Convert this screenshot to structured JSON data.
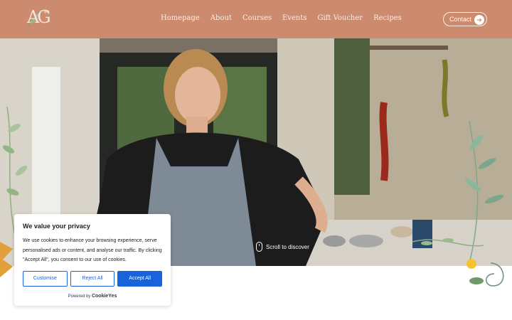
{
  "header": {
    "logo_text": "AG",
    "nav": [
      "Homepage",
      "About",
      "Courses",
      "Events",
      "Gift Voucher",
      "Recipes"
    ],
    "contact_label": "Contact",
    "bg_color": "#cc8a6e"
  },
  "hero": {
    "scroll_label": "Scroll to discover"
  },
  "cookie_banner": {
    "title": "We value your privacy",
    "body": "We use cookies to enhance your browsing experience, serve personalised ads or content, and analyse our traffic. By clicking \"Accept All\", you consent to our use of cookies.",
    "customise_label": "Customise",
    "reject_label": "Reject All",
    "accept_label": "Accept All",
    "powered_by": "Powered by",
    "brand": "CookieYes",
    "accent_color": "#1863dc"
  }
}
